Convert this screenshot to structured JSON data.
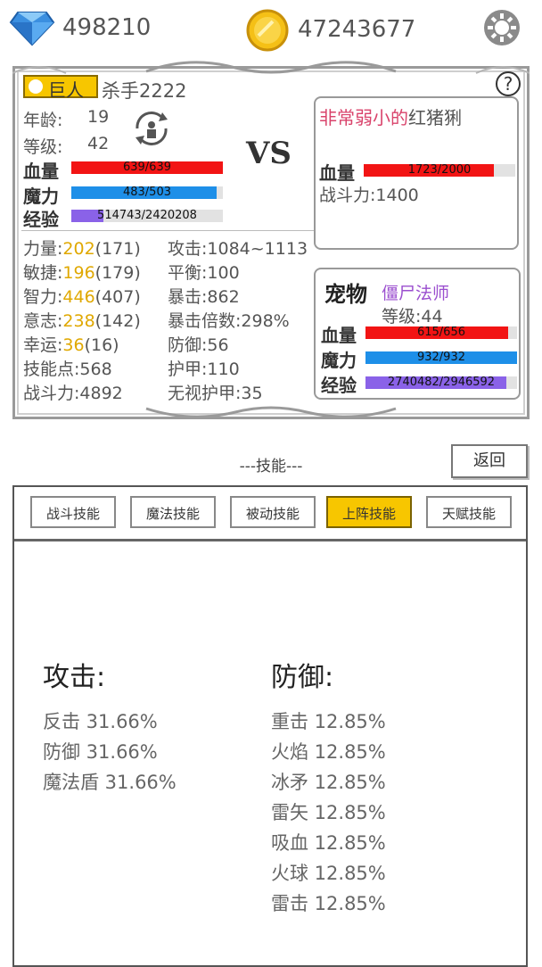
{
  "currency": {
    "gems": "498210",
    "coins": "47243677"
  },
  "player": {
    "class_badge": "巨人",
    "name": "杀手2222",
    "age_label": "年龄:",
    "age": "19",
    "level_label": "等级:",
    "level": "42",
    "hp_label": "血量",
    "hp_text": "639/639",
    "hp_frac": 1.0,
    "mp_label": "魔力",
    "mp_text": "483/503",
    "mp_frac": 0.96,
    "exp_label": "经验",
    "exp_text": "514743/2420208",
    "exp_frac": 0.21
  },
  "vs": "VS",
  "stats_left": [
    {
      "label": "力量:",
      "value": "202",
      "base": "(171)"
    },
    {
      "label": "敏捷:",
      "value": "196",
      "base": "(179)"
    },
    {
      "label": "智力:",
      "value": "446",
      "base": "(407)"
    },
    {
      "label": "意志:",
      "value": "238",
      "base": "(142)"
    },
    {
      "label": "幸运:",
      "value": "36",
      "base": "(16)"
    },
    {
      "label": "技能点:568",
      "value": "",
      "base": ""
    },
    {
      "label": "战斗力:4892",
      "value": "",
      "base": ""
    }
  ],
  "stats_right": [
    "攻击:1084~1113",
    "平衡:100",
    "暴击:862",
    "暴击倍数:298%",
    "防御:56",
    "护甲:110",
    "无视护甲:35"
  ],
  "enemy": {
    "name_prefix": "非常弱小的",
    "name": "红猪猁",
    "hp_label": "血量",
    "hp_text": "1723/2000",
    "hp_frac": 0.86,
    "power": "战斗力:1400"
  },
  "pet": {
    "title": "宠物",
    "name": "僵尸法师",
    "level": "等级:44",
    "hp_label": "血量",
    "hp_text": "615/656",
    "hp_frac": 0.94,
    "mp_label": "魔力",
    "mp_text": "932/932",
    "mp_frac": 1.0,
    "exp_label": "经验",
    "exp_text": "2740482/2946592",
    "exp_frac": 0.93
  },
  "section_title": "---技能---",
  "back_button": "返回",
  "help": "?",
  "tabs": [
    {
      "label": "战斗技能",
      "active": false
    },
    {
      "label": "魔法技能",
      "active": false
    },
    {
      "label": "被动技能",
      "active": false
    },
    {
      "label": "上阵技能",
      "active": true
    },
    {
      "label": "天赋技能",
      "active": false
    }
  ],
  "attack": {
    "heading": "攻击:",
    "items": [
      "反击 31.66%",
      "防御 31.66%",
      "魔法盾 31.66%"
    ]
  },
  "defense": {
    "heading": "防御:",
    "items": [
      "重击 12.85%",
      "火焰 12.85%",
      "冰矛 12.85%",
      "雷矢 12.85%",
      "吸血 12.85%",
      "火球 12.85%",
      "雷击 12.85%"
    ]
  },
  "colors": {
    "hp": "#f21414",
    "mp": "#1e8fe8",
    "exp": "#8a62e8",
    "accent": "#f7c600",
    "enemy_prefix": "#d9436b",
    "pet_name": "#9b4fcf"
  }
}
